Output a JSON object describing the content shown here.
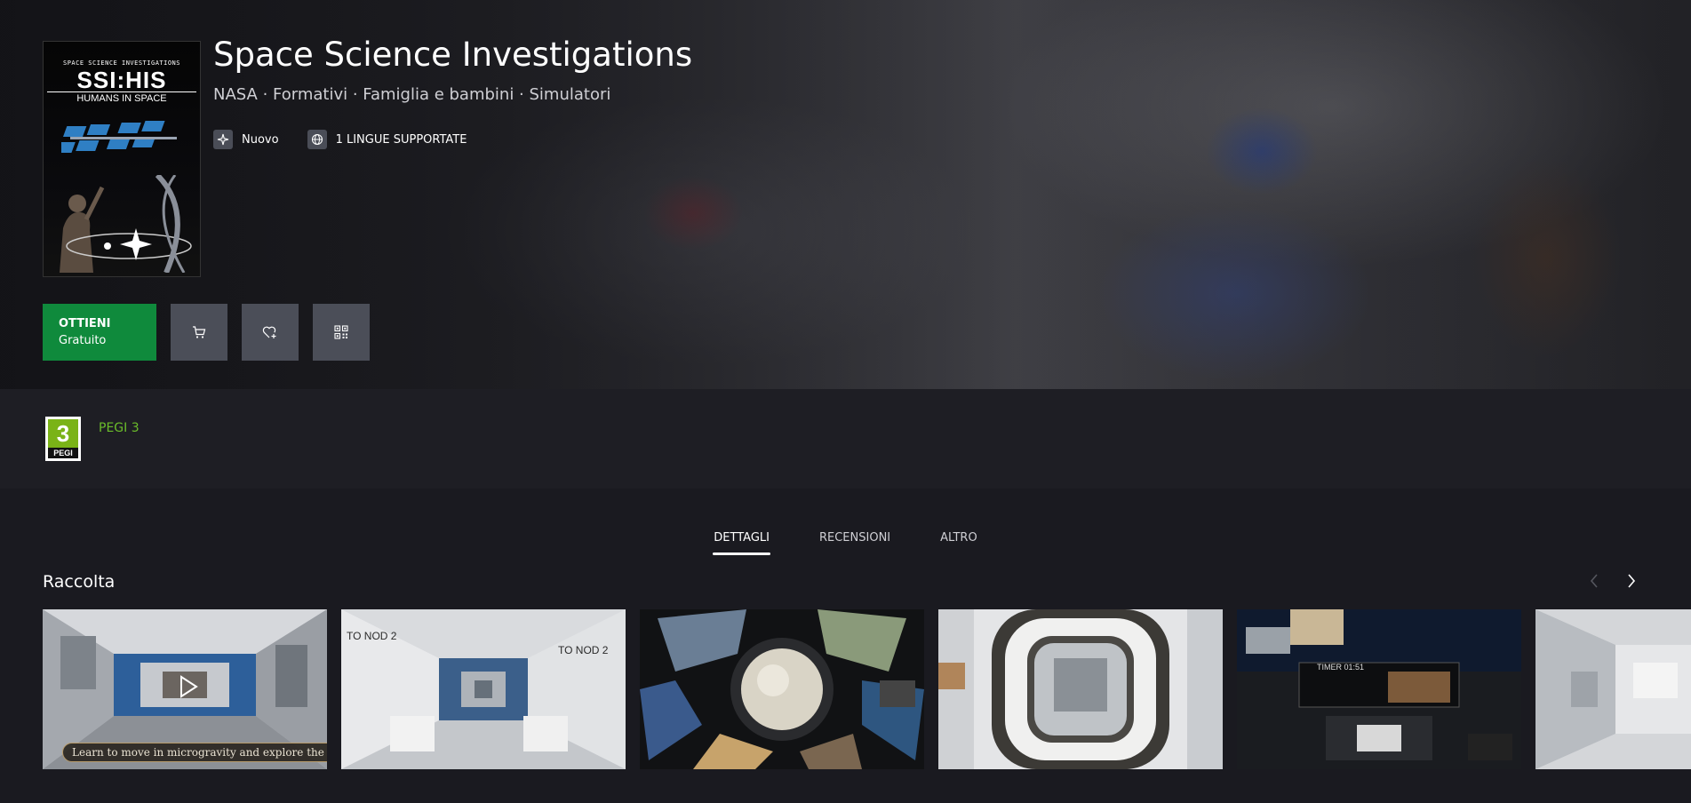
{
  "product": {
    "title": "Space Science Investigations",
    "subtitle": "NASA · Formativi · Famiglia e bambini · Simulatori",
    "cover": {
      "top_text": "SPACE SCIENCE INVESTIGATIONS",
      "logo": "SSI:HIS",
      "sub": "HUMANS IN SPACE"
    },
    "badges": [
      {
        "label": "Nuovo",
        "icon": "sparkle-icon"
      },
      {
        "label": "1 LINGUE SUPPORTATE",
        "icon": "globe-icon"
      }
    ]
  },
  "actions": {
    "get_label": "OTTIENI",
    "get_price": "Gratuito",
    "cart_icon": "cart-icon",
    "wishlist_icon": "heart-plus-icon",
    "qr_icon": "qr-code-icon"
  },
  "rating": {
    "pegi_number": "3",
    "pegi_label": "PEGI",
    "text": "PEGI 3"
  },
  "tabs": [
    {
      "label": "DETTAGLI",
      "active": true
    },
    {
      "label": "RECENSIONI",
      "active": false
    },
    {
      "label": "ALTRO",
      "active": false
    }
  ],
  "gallery": {
    "title": "Raccolta",
    "caption": "Learn to move in microgravity and explore the ISS",
    "thumbs": [
      {
        "scene": "iss-interior-video"
      },
      {
        "scene": "iss-corridor",
        "sign_left": "TO NOD 2",
        "sign_right": "TO NOD 2"
      },
      {
        "scene": "cupola-window"
      },
      {
        "scene": "hatch-view"
      },
      {
        "scene": "control-panel",
        "timer": "TIMER 01:51"
      },
      {
        "scene": "iss-module"
      }
    ]
  },
  "colors": {
    "accent_green": "#0f8a3c",
    "pegi_green": "#7ab317",
    "pegi_text": "#6bbd2a",
    "button_gray": "#4b4e58"
  }
}
